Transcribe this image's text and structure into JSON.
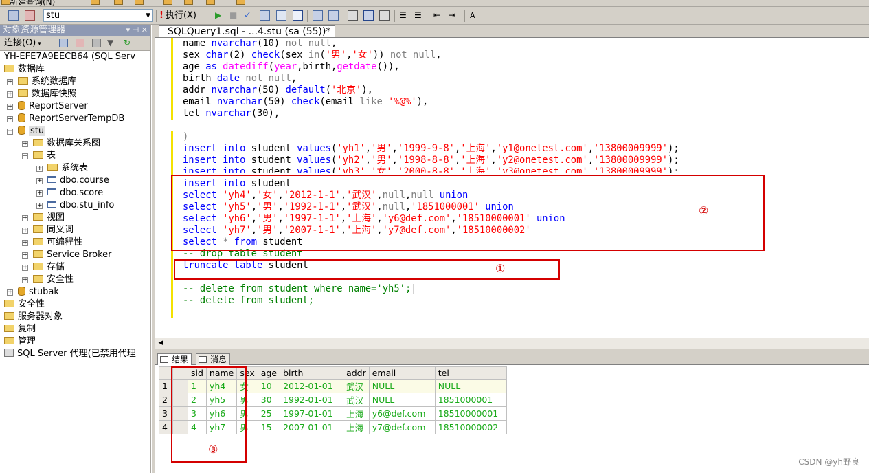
{
  "top_toolbar": {
    "new_query": "新建查询(N)"
  },
  "toolbar": {
    "database": "stu",
    "execute": "执行(X)"
  },
  "object_explorer": {
    "title": "对象资源管理器",
    "title_controls": "▾ ⊣ ✕",
    "connect": "连接(O)",
    "server": "YH-EFE7A9EECB64 (SQL Serv",
    "nodes": {
      "databases": "数据库",
      "system_dbs": "系统数据库",
      "snapshots": "数据库快照",
      "reportserver": "ReportServer",
      "reportservertemp": "ReportServerTempDB",
      "stu": "stu",
      "diagrams": "数据库关系图",
      "tables": "表",
      "systables": "系统表",
      "course": "dbo.course",
      "score": "dbo.score",
      "stu_info": "dbo.stu_info",
      "views": "视图",
      "synonyms": "同义词",
      "programmability": "可编程性",
      "service_broker": "Service Broker",
      "storage": "存储",
      "security_db": "安全性",
      "stubak": "stubak",
      "security": "安全性",
      "server_objects": "服务器对象",
      "replication": "复制",
      "management": "管理",
      "agent": "SQL Server 代理(已禁用代理"
    }
  },
  "editor": {
    "tab_title": "SQLQuery1.sql - ...4.stu (sa (55))*"
  },
  "annotations": {
    "a1": "①",
    "a2": "②",
    "a3": "③"
  },
  "results": {
    "tab_results": "结果",
    "tab_messages": "消息",
    "columns": [
      "sid",
      "name",
      "sex",
      "age",
      "birth",
      "addr",
      "email",
      "tel"
    ],
    "rows": [
      [
        "1",
        "1",
        "yh4",
        "女",
        "10",
        "2012-01-01",
        "武汉",
        "NULL",
        "NULL"
      ],
      [
        "2",
        "2",
        "yh5",
        "男",
        "30",
        "1992-01-01",
        "武汉",
        "NULL",
        "1851000001"
      ],
      [
        "3",
        "3",
        "yh6",
        "男",
        "25",
        "1997-01-01",
        "上海",
        "y6@def.com",
        "18510000001"
      ],
      [
        "4",
        "4",
        "yh7",
        "男",
        "15",
        "2007-01-01",
        "上海",
        "y7@def.com",
        "18510000002"
      ]
    ]
  },
  "watermark": "CSDN @yh野良"
}
